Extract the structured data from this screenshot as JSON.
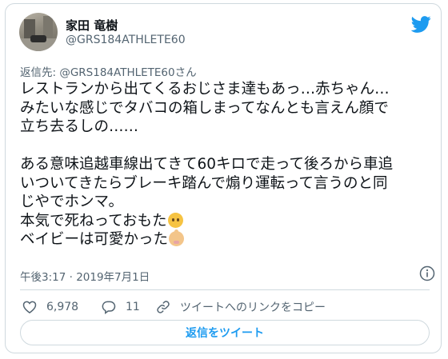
{
  "user": {
    "display_name": "家田 竜樹",
    "handle": "@GRS184ATHLETE60"
  },
  "tweet": {
    "replying_to": "返信先: @GRS184ATHLETE60さん",
    "lines": [
      "レストランから出てくるおじさま達もあっ…赤ちゃん…",
      "みたいな感じでタバコの箱しまってなんとも言えん顔で",
      "立ち去るしの……",
      "",
      "ある意味追越車線出てきて60キロで走って後ろから車追",
      "いついてきたらブレーキ踏んで煽り運転って言うのと同",
      "じやでホンマ。",
      "本気で死ねっておもた",
      "ベイビーは可愛かった"
    ],
    "emoji_1": "neutral-face-emoji",
    "emoji_2": "baby-emoji",
    "timestamp": "午後3:17 · 2019年7月1日"
  },
  "actions": {
    "like_count": "6,978",
    "reply_count": "11",
    "copy_link_label": "ツイートへのリンクをコピー",
    "reply_button_label": "返信をツイート"
  },
  "colors": {
    "accent": "#1d9bf0",
    "secondary_text": "#536471",
    "border": "#cfd9de"
  },
  "icons": [
    "twitter-bird-icon",
    "info-icon",
    "heart-icon",
    "reply-bubble-icon",
    "link-icon"
  ]
}
